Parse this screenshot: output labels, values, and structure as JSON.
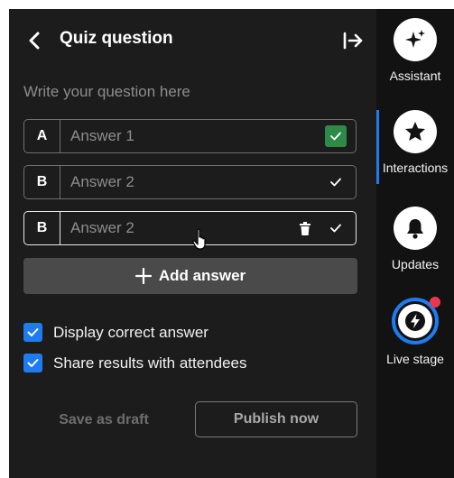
{
  "header": {
    "title": "Quiz question"
  },
  "question": {
    "placeholder": "Write your question here",
    "value": ""
  },
  "answers": [
    {
      "letter": "A",
      "placeholder": "Answer 1",
      "correct": true
    },
    {
      "letter": "B",
      "placeholder": "Answer 2",
      "correct": false
    },
    {
      "letter": "B",
      "placeholder": "Answer 2",
      "correct": false
    }
  ],
  "add_answer": {
    "label": "Add answer"
  },
  "options": [
    {
      "label": "Display correct answer",
      "checked": true
    },
    {
      "label": "Share results with attendees",
      "checked": true
    }
  ],
  "footer": {
    "draft_label": "Save as draft",
    "publish_label": "Publish now"
  },
  "rail": {
    "assistant": "Assistant",
    "interactions": "Interactions",
    "updates": "Updates",
    "live_stage": "Live stage"
  },
  "colors": {
    "panel_bg": "#1c1c1c",
    "rail_bg": "#121212",
    "accent_blue": "#1d7cf2",
    "correct_green": "#2e8b47",
    "notification_red": "#e8384f"
  }
}
